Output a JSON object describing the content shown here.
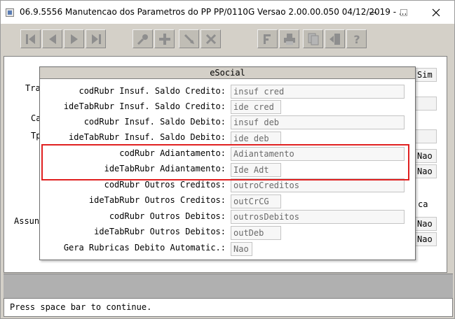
{
  "window": {
    "title": "06.9.5556 Manutencao dos  Parametros do PP PP/0110G Versao 2.00.00.050 04/12/2019 - ...",
    "min_glyph": "—",
    "max_glyph": "☐",
    "close_glyph": "✕"
  },
  "toolbar": {
    "buttons": [
      {
        "name": "first-record-icon"
      },
      {
        "name": "previous-record-icon"
      },
      {
        "name": "next-record-icon"
      },
      {
        "name": "last-record-icon"
      },
      {
        "name": "goto-key-icon"
      },
      {
        "name": "add-record-icon"
      },
      {
        "name": "edit-record-icon"
      },
      {
        "name": "delete-record-icon"
      },
      {
        "name": "filter-icon"
      },
      {
        "name": "print-icon"
      },
      {
        "name": "copy-icon"
      },
      {
        "name": "exit-icon"
      },
      {
        "name": "help-icon"
      }
    ]
  },
  "background": {
    "fragments": {
      "tra": "Tra",
      "ca": "Ca",
      "tp": "Tp",
      "assun": "Assun",
      "ca_right": "ca"
    },
    "right_values": {
      "sim": "Sim",
      "nao1": "Nao",
      "nao2": "Nao",
      "nao3": "Nao",
      "nao4": "Nao"
    }
  },
  "dialog": {
    "title": "eSocial",
    "rows": [
      {
        "label": "codRubr Insuf. Saldo Credito:",
        "value": "insuf cred"
      },
      {
        "label": "ideTabRubr Insuf. Saldo Credito:",
        "value": "ide cred"
      },
      {
        "label": "codRubr Insuf. Saldo Debito:",
        "value": "insuf deb"
      },
      {
        "label": "ideTabRubr Insuf. Saldo Debito:",
        "value": "ide deb"
      },
      {
        "label": "codRubr Adiantamento:",
        "value": "Adiantamento"
      },
      {
        "label": "ideTabRubr Adiantamento:",
        "value": "Ide Adt"
      },
      {
        "label": "codRubr Outros Creditos:",
        "value": "outroCreditos"
      },
      {
        "label": "ideTabRubr Outros Creditos:",
        "value": "outCrCG"
      },
      {
        "label": "codRubr Outros Debitos:",
        "value": "outrosDebitos"
      },
      {
        "label": "ideTabRubr Outros Debitos:",
        "value": "outDeb"
      },
      {
        "label": "Gera Rubricas Debito Automatic.:",
        "value": "Nao"
      }
    ]
  },
  "status": {
    "message": "Press space bar to continue."
  },
  "colors": {
    "highlight": "#e02020",
    "window_bg": "#d4d0c8"
  }
}
